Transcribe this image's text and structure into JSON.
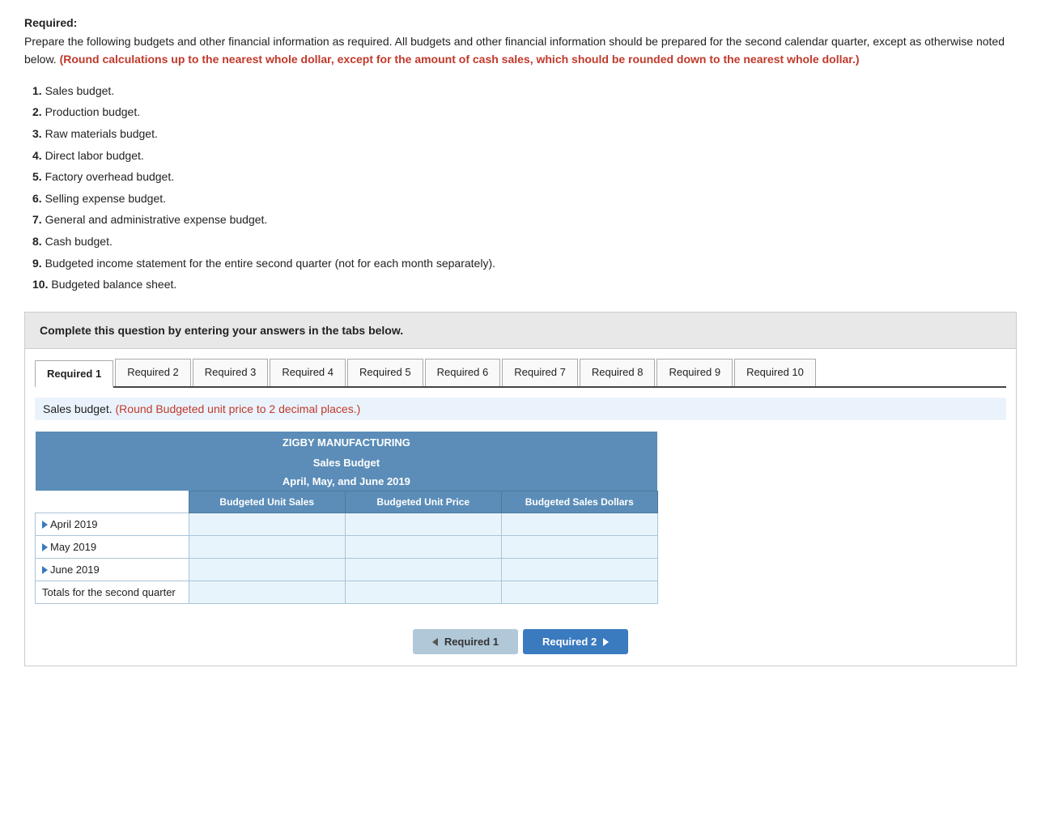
{
  "page": {
    "required_label": "Required:",
    "intro": "Prepare the following budgets and other financial information as required. All budgets and other financial information should be prepared for the second calendar quarter, except as otherwise noted below.",
    "highlight": "(Round calculations up to the nearest whole dollar, except for the amount of cash sales, which should be rounded down to the nearest whole dollar.)",
    "items": [
      {
        "num": "1.",
        "text": "Sales budget."
      },
      {
        "num": "2.",
        "text": "Production budget."
      },
      {
        "num": "3.",
        "text": "Raw materials budget."
      },
      {
        "num": "4.",
        "text": "Direct labor budget."
      },
      {
        "num": "5.",
        "text": "Factory overhead budget."
      },
      {
        "num": "6.",
        "text": "Selling expense budget."
      },
      {
        "num": "7.",
        "text": "General and administrative expense budget."
      },
      {
        "num": "8.",
        "text": "Cash budget."
      },
      {
        "num": "9.",
        "text": "Budgeted income statement for the entire second quarter (not for each month separately)."
      },
      {
        "num": "10.",
        "text": "Budgeted balance sheet."
      }
    ],
    "banner": "Complete this question by entering your answers in the tabs below."
  },
  "tabs": [
    {
      "label": "Required 1",
      "active": true
    },
    {
      "label": "Required 2",
      "active": false
    },
    {
      "label": "Required 3",
      "active": false
    },
    {
      "label": "Required 4",
      "active": false
    },
    {
      "label": "Required 5",
      "active": false
    },
    {
      "label": "Required 6",
      "active": false
    },
    {
      "label": "Required 7",
      "active": false
    },
    {
      "label": "Required 8",
      "active": false
    },
    {
      "label": "Required 9",
      "active": false
    },
    {
      "label": "Required 10",
      "active": false
    }
  ],
  "sales_budget": {
    "note_normal": "Sales budget.",
    "note_red": "(Round Budgeted unit price to 2 decimal places.)",
    "table": {
      "company": "ZIGBY MANUFACTURING",
      "title": "Sales Budget",
      "subtitle": "April, May, and June 2019",
      "col1": "Budgeted Unit Sales",
      "col2": "Budgeted Unit Price",
      "col3": "Budgeted Sales Dollars",
      "rows": [
        {
          "label": "April 2019"
        },
        {
          "label": "May 2019"
        },
        {
          "label": "June 2019"
        },
        {
          "label": "Totals for the second quarter"
        }
      ]
    }
  },
  "nav": {
    "prev_label": "Required 1",
    "next_label": "Required 2"
  }
}
